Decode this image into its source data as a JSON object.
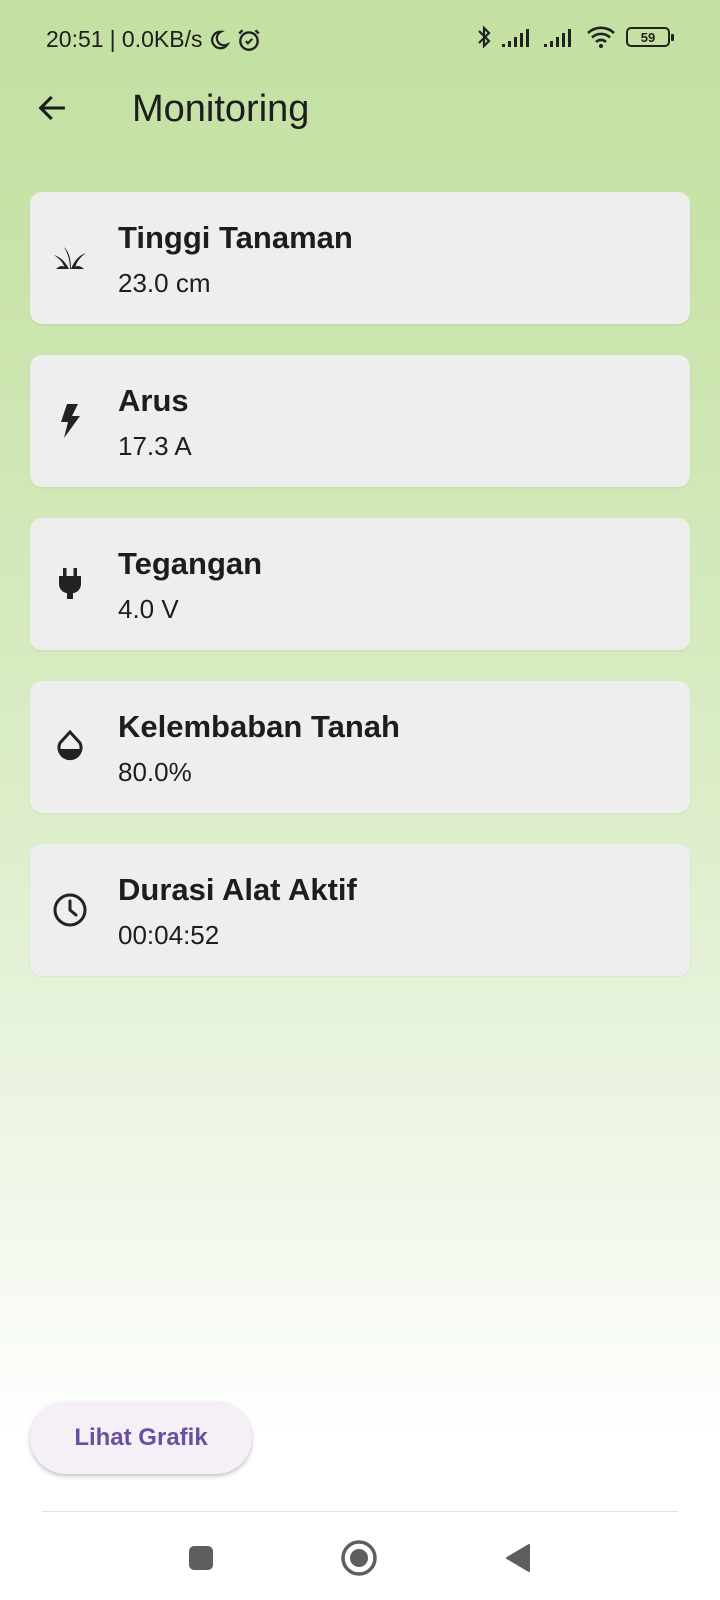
{
  "status_bar": {
    "time": "20:51",
    "speed": "| 0.0KB/s",
    "battery": "59"
  },
  "app_bar": {
    "title": "Monitoring"
  },
  "cards": [
    {
      "icon": "plant-icon",
      "label": "Tinggi Tanaman",
      "value": "23.0 cm"
    },
    {
      "icon": "lightning-icon",
      "label": "Arus",
      "value": "17.3 A"
    },
    {
      "icon": "plug-icon",
      "label": "Tegangan",
      "value": "4.0 V"
    },
    {
      "icon": "water-drop-icon",
      "label": "Kelembaban Tanah",
      "value": "80.0%"
    },
    {
      "icon": "clock-icon",
      "label": "Durasi Alat Aktif",
      "value": "00:04:52"
    }
  ],
  "button": {
    "label": "Lihat Grafik"
  },
  "colors": {
    "background_top": "#c3e0a2",
    "card": "#eeeeee",
    "button_text": "#6a4fa0"
  }
}
